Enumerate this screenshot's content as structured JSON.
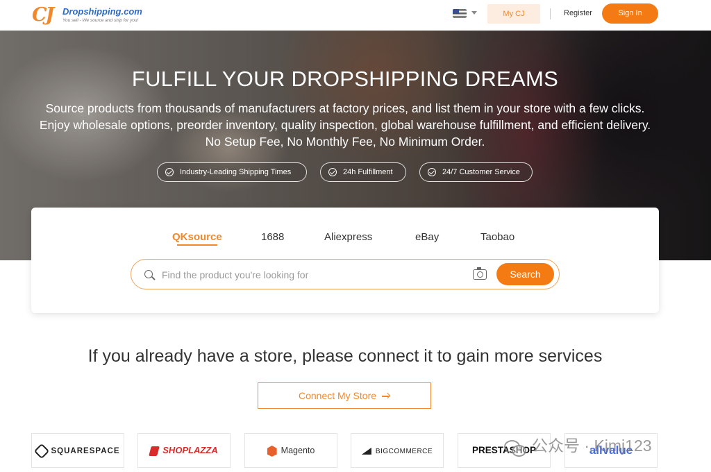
{
  "header": {
    "logo_mark": "CJ",
    "logo_name": "Dropshipping.com",
    "logo_tagline": "You sell - We source and ship for you!",
    "language_flag": "us-flag-icon",
    "my_cj": "My CJ",
    "register": "Register",
    "sign_in": "Sign In",
    "accent_color": "#f47b13"
  },
  "hero": {
    "title": "FULFILL YOUR DROPSHIPPING DREAMS",
    "description": "Source products from thousands of manufacturers at factory prices, and list them in your store with a few clicks. Enjoy wholesale options, preorder inventory, quality inspection, global warehouse fulfillment, and efficient delivery. No Setup Fee, No Monthly Fee, No Minimum Order.",
    "features": [
      "Industry-Leading Shipping Times",
      "24h Fulfillment",
      "24/7 Customer Service"
    ]
  },
  "search": {
    "tabs": [
      "QKsource",
      "1688",
      "Aliexpress",
      "eBay",
      "Taobao"
    ],
    "active_tab": "QKsource",
    "placeholder": "Find the product you're looking for",
    "button": "Search"
  },
  "connect": {
    "title": "If you already have a store, please connect it to gain more services",
    "button": "Connect My Store"
  },
  "platforms": [
    "SQUARESPACE",
    "SHOPLAZZA",
    "Magento",
    "BIGCOMMERCE",
    "PRESTASHOP",
    "allvalue"
  ],
  "watermark": "公众号 · Kimj123"
}
